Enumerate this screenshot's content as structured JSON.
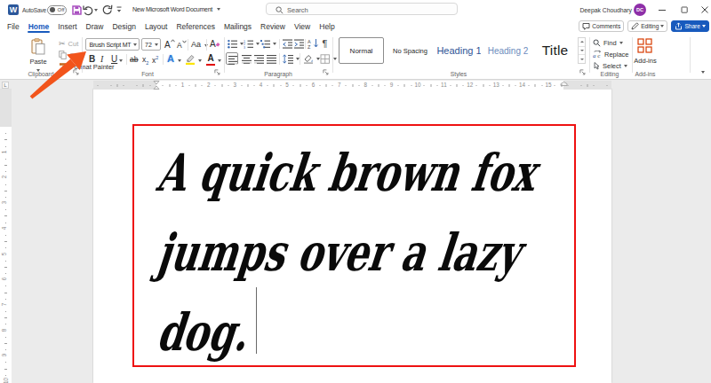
{
  "titlebar": {
    "autosave_label": "AutoSave",
    "autosave_state": "Off",
    "document_title": "New Microsoft Word Document",
    "search_placeholder": "Search",
    "user_name": "Deepak Choudhary",
    "user_initials": "DC"
  },
  "menubar": {
    "tabs": [
      "File",
      "Home",
      "Insert",
      "Draw",
      "Design",
      "Layout",
      "References",
      "Mailings",
      "Review",
      "View",
      "Help"
    ],
    "active_tab": "Home",
    "comments_label": "Comments",
    "editing_label": "Editing",
    "share_label": "Share"
  },
  "ribbon": {
    "clipboard": {
      "group_label": "Clipboard",
      "paste_label": "Paste",
      "cut_label": "Cut",
      "copy_label": "Copy",
      "format_painter_label": "Format Painter"
    },
    "font": {
      "group_label": "Font",
      "font_name": "Brush Script MT",
      "font_size": "72",
      "bold_label": "B",
      "italic_label": "I",
      "underline_label": "U",
      "strikethrough_label": "ab",
      "subscript_label": "x",
      "superscript_label": "x",
      "change_case_label": "Aa",
      "clear_format_label": "A",
      "grow_font_label": "A",
      "shrink_font_label": "A",
      "text_effects_label": "A",
      "font_color_label": "A"
    },
    "paragraph": {
      "group_label": "Paragraph"
    },
    "styles": {
      "group_label": "Styles",
      "items": [
        {
          "label": "Normal",
          "class": "st-normal",
          "selected": true
        },
        {
          "label": "No Spacing",
          "class": "st-nospacing",
          "selected": false
        },
        {
          "label": "Heading 1",
          "class": "st-heading1",
          "selected": false
        },
        {
          "label": "Heading 2",
          "class": "st-heading2",
          "selected": false
        },
        {
          "label": "Title",
          "class": "st-title",
          "selected": false
        }
      ]
    },
    "editing": {
      "group_label": "Editing",
      "find_label": "Find",
      "replace_label": "Replace",
      "select_label": "Select"
    },
    "addins": {
      "group_label": "Add-ins",
      "button_label": "Add-ins"
    }
  },
  "ruler": {
    "horizontal_numbers": [
      1,
      2,
      3,
      4,
      5,
      6,
      7,
      8,
      9,
      10,
      11,
      12,
      13,
      14,
      15
    ],
    "vertical_numbers": [
      1,
      2,
      3,
      4,
      5,
      6,
      7,
      8,
      9,
      10
    ]
  },
  "document": {
    "lines": [
      "A quick brown fox",
      "jumps over a lazy",
      "dog."
    ]
  },
  "colors": {
    "accent_blue": "#185abd",
    "red_box": "#ee1111",
    "arrow_orange": "#f2541b",
    "save_icon_purple": "#b14cc4",
    "avatar_purple": "#8e2fa8",
    "addins_orange": "#d83b01"
  }
}
